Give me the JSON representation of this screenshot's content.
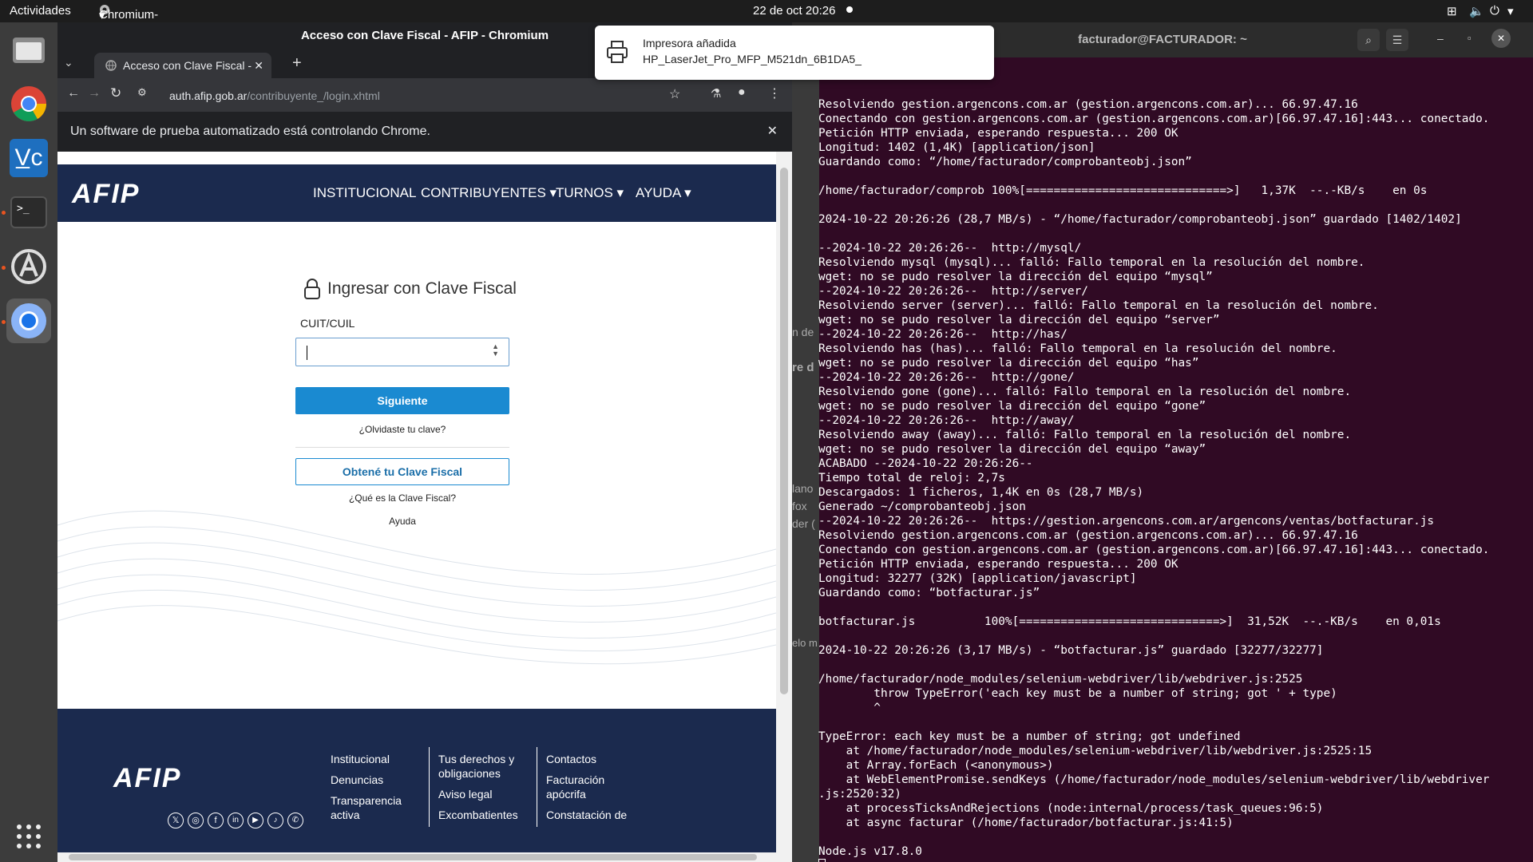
{
  "topbar": {
    "activities": "Actividades",
    "app_menu": "Chromium-browser",
    "clock": "22 de oct  20:26"
  },
  "browser": {
    "window_title": "Acceso con Clave Fiscal - AFIP - Chromium",
    "tab_title": "Acceso con Clave Fiscal - ",
    "url_host": "auth.afip.gob.ar",
    "url_path": "/contribuyente_/login.xhtml",
    "infobar": "Un software de prueba automatizado está controlando Chrome."
  },
  "afip": {
    "logo": "AFIP",
    "nav": [
      "INSTITUCIONAL",
      "CONTRIBUYENTES ▾",
      "TURNOS ▾",
      "AYUDA ▾"
    ],
    "login_title": "Ingresar con Clave Fiscal",
    "cuit_label": "CUIT/CUIL",
    "next_button": "Siguiente",
    "forgot": "¿Olvidaste tu clave?",
    "get_key": "Obtené tu Clave Fiscal",
    "what_is": "¿Qué es la Clave Fiscal?",
    "help": "Ayuda"
  },
  "footer": {
    "col1": [
      "Institucional",
      "Denuncias",
      "Transparencia",
      "activa"
    ],
    "col2": [
      "Tus derechos y",
      "obligaciones",
      "Aviso legal",
      "Excombatientes"
    ],
    "col3": [
      "Contactos",
      "Facturación",
      "apócrifa",
      "Constatación de"
    ]
  },
  "notification": {
    "title": "Impresora añadida",
    "body": "HP_LaserJet_Pro_MFP_M521dn_6B1DA5_"
  },
  "terminal": {
    "title": "facturador@FACTURADOR: ~",
    "side_fragments": [
      "n de",
      "re d",
      "lano",
      "fox",
      "der (",
      "elo m"
    ],
    "lines": [
      "Resolviendo gestion.argencons.com.ar (gestion.argencons.com.ar)... 66.97.47.16",
      "Conectando con gestion.argencons.com.ar (gestion.argencons.com.ar)[66.97.47.16]:443... conectado.",
      "Petición HTTP enviada, esperando respuesta... 200 OK",
      "Longitud: 1402 (1,4K) [application/json]",
      "Guardando como: “/home/facturador/comprobanteobj.json”",
      "",
      "/home/facturador/comprob 100%[=============================>]   1,37K  --.-KB/s    en 0s",
      "",
      "2024-10-22 20:26:26 (28,7 MB/s) - “/home/facturador/comprobanteobj.json” guardado [1402/1402]",
      "",
      "--2024-10-22 20:26:26--  http://mysql/",
      "Resolviendo mysql (mysql)... falló: Fallo temporal en la resolución del nombre.",
      "wget: no se pudo resolver la dirección del equipo “mysql”",
      "--2024-10-22 20:26:26--  http://server/",
      "Resolviendo server (server)... falló: Fallo temporal en la resolución del nombre.",
      "wget: no se pudo resolver la dirección del equipo “server”",
      "--2024-10-22 20:26:26--  http://has/",
      "Resolviendo has (has)... falló: Fallo temporal en la resolución del nombre.",
      "wget: no se pudo resolver la dirección del equipo “has”",
      "--2024-10-22 20:26:26--  http://gone/",
      "Resolviendo gone (gone)... falló: Fallo temporal en la resolución del nombre.",
      "wget: no se pudo resolver la dirección del equipo “gone”",
      "--2024-10-22 20:26:26--  http://away/",
      "Resolviendo away (away)... falló: Fallo temporal en la resolución del nombre.",
      "wget: no se pudo resolver la dirección del equipo “away”",
      "ACABADO --2024-10-22 20:26:26--",
      "Tiempo total de reloj: 2,7s",
      "Descargados: 1 ficheros, 1,4K en 0s (28,7 MB/s)",
      "Generado ~/comprobanteobj.json",
      "--2024-10-22 20:26:26--  https://gestion.argencons.com.ar/argencons/ventas/botfacturar.js",
      "Resolviendo gestion.argencons.com.ar (gestion.argencons.com.ar)... 66.97.47.16",
      "Conectando con gestion.argencons.com.ar (gestion.argencons.com.ar)[66.97.47.16]:443... conectado.",
      "Petición HTTP enviada, esperando respuesta... 200 OK",
      "Longitud: 32277 (32K) [application/javascript]",
      "Guardando como: “botfacturar.js”",
      "",
      "botfacturar.js          100%[=============================>]  31,52K  --.-KB/s    en 0,01s",
      "",
      "2024-10-22 20:26:26 (3,17 MB/s) - “botfacturar.js” guardado [32277/32277]",
      "",
      "/home/facturador/node_modules/selenium-webdriver/lib/webdriver.js:2525",
      "        throw TypeError('each key must be a number of string; got ' + type)",
      "        ^",
      "",
      "TypeError: each key must be a number of string; got undefined",
      "    at /home/facturador/node_modules/selenium-webdriver/lib/webdriver.js:2525:15",
      "    at Array.forEach (<anonymous>)",
      "    at WebElementPromise.sendKeys (/home/facturador/node_modules/selenium-webdriver/lib/webdriver",
      ".js:2520:32)",
      "    at processTicksAndRejections (node:internal/process/task_queues:96:5)",
      "    at async facturar (/home/facturador/botfacturar.js:41:5)",
      "",
      "Node.js v17.8.0"
    ]
  }
}
